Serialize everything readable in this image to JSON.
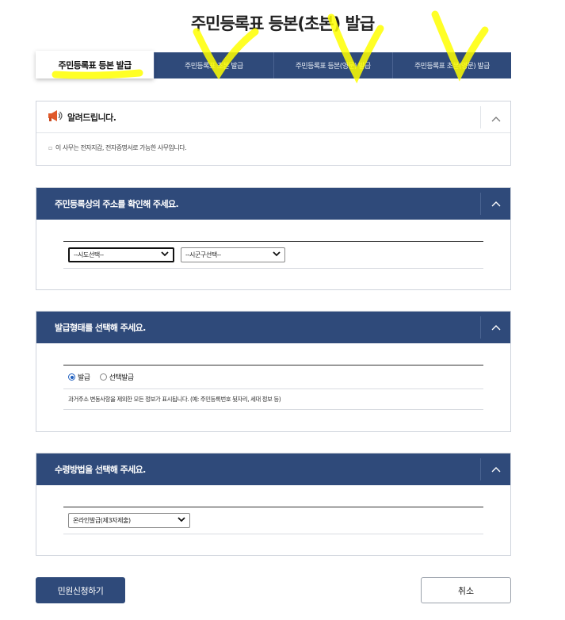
{
  "page": {
    "title": "주민등록표 등본(초본) 발급"
  },
  "tabs": [
    {
      "label": "주민등록표 등본 발급",
      "active": true
    },
    {
      "label": "주민등록표 초본 발급",
      "active": false
    },
    {
      "label": "주민등록표 등본(영문) 발급",
      "active": false
    },
    {
      "label": "주민등록표 초본(영문) 발급",
      "active": false
    }
  ],
  "notice": {
    "title": "알려드립니다.",
    "bullet": "▫",
    "text": "이 사무는 전자지갑, 전자증명서로 가능한 사무입니다."
  },
  "address_section": {
    "title": "주민등록상의 주소를 확인해 주세요.",
    "sido_select": {
      "selected": "--시도선택--"
    },
    "sigungu_select": {
      "selected": "--시군구선택--"
    }
  },
  "issue_type_section": {
    "title": "발급형태를 선택해 주세요.",
    "options": [
      {
        "label": "발급",
        "checked": true
      },
      {
        "label": "선택발급",
        "checked": false
      }
    ],
    "description": "과거주소 변동사항을 제외한 모든 정보가 표시됩니다. (예: 주민등록번호 뒷자리, 세대 정보 등)"
  },
  "receipt_section": {
    "title": "수령방법을 선택해 주세요.",
    "method_select": {
      "selected": "온라인발급(제3자제출)"
    }
  },
  "buttons": {
    "submit_label": "민원신청하기",
    "cancel_label": "취소"
  },
  "colors": {
    "header_blue": "#2f4a7a",
    "highlighter_yellow": "#ffff00"
  }
}
